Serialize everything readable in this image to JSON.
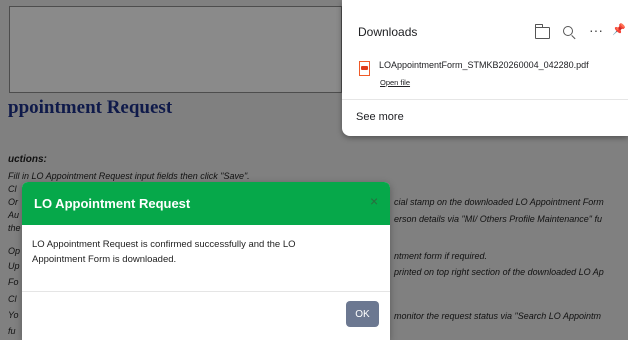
{
  "page": {
    "title": "ppointment Request",
    "instructions_label": "uctions:",
    "lines_right": [
      "cial stamp on the downloaded LO Appointment Form",
      "erson details via \"MI/ Others Profile Maintenance\" fu",
      "ntment form if required.",
      "printed on top right section of the downloaded LO Ap",
      "monitor the request status via \"Search LO Appointm"
    ],
    "lines_left": [
      "Fill in LO Appointment Request input fields then click \"Save\".",
      "Cl",
      "Or",
      "Au",
      "the",
      "Op",
      "Up",
      "Fo",
      "Cl",
      "Yo",
      "fu"
    ]
  },
  "downloads": {
    "title": "Downloads",
    "icons": [
      "folder-icon",
      "search-icon",
      "more-icon",
      "pin-icon"
    ],
    "more_glyph": "···",
    "pin_glyph": "📌",
    "file_name": "LOAppointmentForm_STMKB20260004_042280.pdf",
    "open_label": "Open file",
    "see_more_label": "See more"
  },
  "modal": {
    "title": "LO Appointment Request",
    "close_glyph": "×",
    "message": "LO Appointment Request is confirmed successfully and the LO Appointment Form is downloaded.",
    "ok_label": "OK",
    "header_color": "#06a84a",
    "ok_color": "#6c7891"
  }
}
